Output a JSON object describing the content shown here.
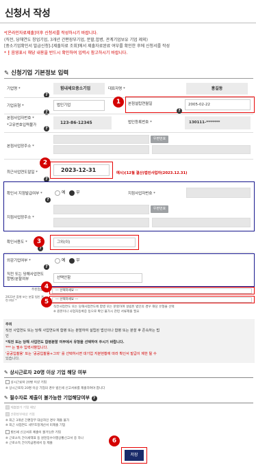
{
  "page": {
    "title": "신청서 작성",
    "intro": [
      "*[온라인자료제출]이후 신청서를 작성하시기 바랍니다.",
      "(직전, 당해연도 창업기업, 3개년 간편장부기업, 분할,합병, 관계기업보유 기업 제외)",
      "[중소기업확인서 발급신청]-[제출자료 조회]에서 제출자료완료 여부를 확인한 후에 신청서를 작성",
      "*❗음영표시 해당 내용을 반드시 확인하여 입력시 참고하시기 바랍니다."
    ]
  },
  "section_basic": {
    "title": "신청기업 기본정보 입력",
    "company_name_label": "기업명 *",
    "company_name_value": "힘내세요중소기업",
    "ceo_label": "대표자명 *",
    "ceo_value": "홍길동",
    "corp_type_label": "기업유형 *",
    "corp_type_value": "법인기업",
    "est_date_label": "본점설립연월일",
    "est_date_value": "2005-02-22",
    "biz_no_label": "본점사업자번호 *",
    "biz_no_note": "*고유번호입력불가",
    "biz_no_value": "123-86-12345",
    "corp_reg_label": "법인등록번호 *",
    "corp_reg_value": "130111-*******",
    "address_label": "본점사업장주소 *",
    "postcode_button": "우편번호",
    "fiscal_label": "최근사업연도말일 *",
    "fiscal_value": "2023-12-31",
    "fiscal_example": "예시)(12월 결산)법인사업자(2023.12.31)",
    "branch_label": "확인서 지점발급여부 *",
    "branch_yes": "예",
    "branch_no": "부",
    "branch_no_label": "지점사업자번호 *",
    "branch_addr_label": "지점사업장주소 *",
    "branch_postcode_button": "우편번호",
    "industry_label": "확인서용도 *",
    "industry_value": "그외(이)",
    "foreign_label": "외감기업여부 *",
    "foreign_yes": "예",
    "foreign_no": "부",
    "prev_label": "직전 또는 당해사업연도 합병/분할여부",
    "prev_value": "선택안함",
    "sub1_label": "주된업종 *",
    "sub1_value": "--- 선택하세요 ---",
    "sub2_label": "2023년 합병 또는 분할 법인 관련 여부 *",
    "sub2_value": "--- 선택하세요 ---",
    "sub2_note1": "직전사업연도 또는 당해사업연도에 합병 또는 분할하여 설립된 법인의 경우 해당 유형을 선택",
    "sub2_note2": "※ 원본이나 사업자등록증 등으로 확인 불가시 관련 서류제출 필요"
  },
  "notice": {
    "title": "주의",
    "lines": [
      "직전 사업연도 또는 당해 사업연도에 합병 또는 분할하여 설립된 법인이나 합병 또는 분할 후 존속하는 법",
      "인",
      "*직전 또는 당해 사업연도 합병분할 여부에서 유형을 선택하여 주시기 바랍니다.",
      "*** 는 필수 입력사항입니다.",
      "'공공입찰용' 또는 '공공입찰용+그외' 를 선택하시면 대기업 지분현황에 따라 확인서 발급이 제한 될 수",
      "있습니다."
    ]
  },
  "section_emp": {
    "title": "상시근로자 20명 이상 기업 해당 여부",
    "check_label": "상시근로자 20명 이상 기업",
    "note": "※ 상시근로자 20명 이상 기업의 경우 법인세 신고서류를 제출하여야 합니다"
  },
  "section_exempt": {
    "title": "필수자료 제출이 불가능한 기업해당여부",
    "check1": "제출불가 기업 해당",
    "check2": "간편장부대상 기업",
    "notes": [
      "※ 최근 3개년 간편장부 대상자인 경우 제출 불가",
      "※ 최근 사업연도 세무조정계산서 미제출 기업"
    ],
    "check3": "법인세 신고서류 제출이 불가능한 기업",
    "notes2": [
      "※ 근로소득 간이세액표 등 원천징수이행상황신고서 중 하나",
      "※ 근로소득 간이지급명세서 등 제출"
    ]
  },
  "actions": {
    "save_label": "저장"
  },
  "annotations": {
    "badge1": "1",
    "badge2": "2",
    "badge3": "3",
    "badge4": "4",
    "badge5": "5",
    "badge6": "6"
  },
  "colors": {
    "highlight_red": "#e60000",
    "highlight_navy": "#14148c",
    "save_button": "#1a2b6a"
  }
}
